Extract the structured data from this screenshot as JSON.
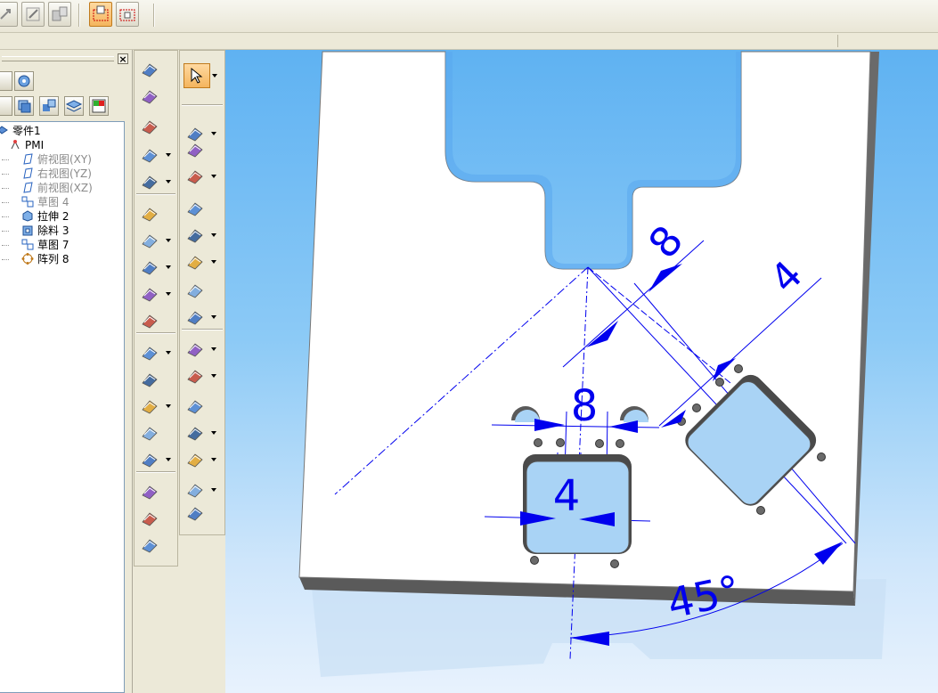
{
  "colors": {
    "dimension_blue": "#0000ee",
    "sky_top": "#5fb2f2",
    "sky_bottom": "#e8f2fd",
    "part_face": "#ffffff",
    "cut_fill": "#a9d3f5",
    "selected_tool": "#f4b55e"
  },
  "top_toolbar": {
    "icons": [
      "relate-icon",
      "edit-icon",
      "parts-icon",
      "select-view-icon",
      "select-edge-icon"
    ]
  },
  "panel": {
    "close_glyph": "×",
    "tree": [
      {
        "label": "零件1",
        "icon": "part-icon",
        "dim": false
      },
      {
        "label": "PMI",
        "icon": "pmi-icon",
        "dim": false
      },
      {
        "label": "俯视图(XY)",
        "icon": "plane-icon",
        "dim": true
      },
      {
        "label": "右视图(YZ)",
        "icon": "plane-icon",
        "dim": true
      },
      {
        "label": "前视图(XZ)",
        "icon": "plane-icon",
        "dim": true
      },
      {
        "label": "草图 4",
        "icon": "sketch-icon",
        "dim": true
      },
      {
        "label": "拉伸 2",
        "icon": "extrude-icon",
        "dim": false
      },
      {
        "label": "除料 3",
        "icon": "cutout-icon",
        "dim": false
      },
      {
        "label": "草图 7",
        "icon": "sketch-icon",
        "dim": false
      },
      {
        "label": "阵列 8",
        "icon": "pattern-icon",
        "dim": false
      }
    ]
  },
  "drawing": {
    "dimensions": {
      "top_gap": "8",
      "angled_width": "4",
      "hole_gap": "8",
      "square_width": "4",
      "angle": "45°"
    }
  }
}
